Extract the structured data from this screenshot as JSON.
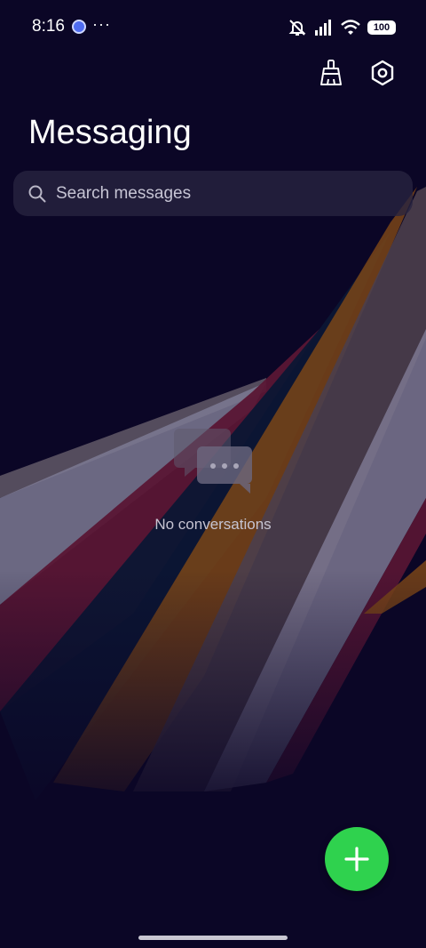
{
  "status_bar": {
    "time": "8:16",
    "more": "···",
    "battery": "100"
  },
  "toolbar": {
    "clean_icon": "broom-icon",
    "settings_icon": "settings-hexagon-icon"
  },
  "header": {
    "title": "Messaging"
  },
  "search": {
    "placeholder": "Search messages"
  },
  "empty_state": {
    "icon": "chat-bubbles-icon",
    "label": "No conversations"
  },
  "fab": {
    "icon": "plus-icon",
    "color": "#2fd24e"
  },
  "colors": {
    "background": "#0b0626",
    "accent": "#2fd24e"
  }
}
